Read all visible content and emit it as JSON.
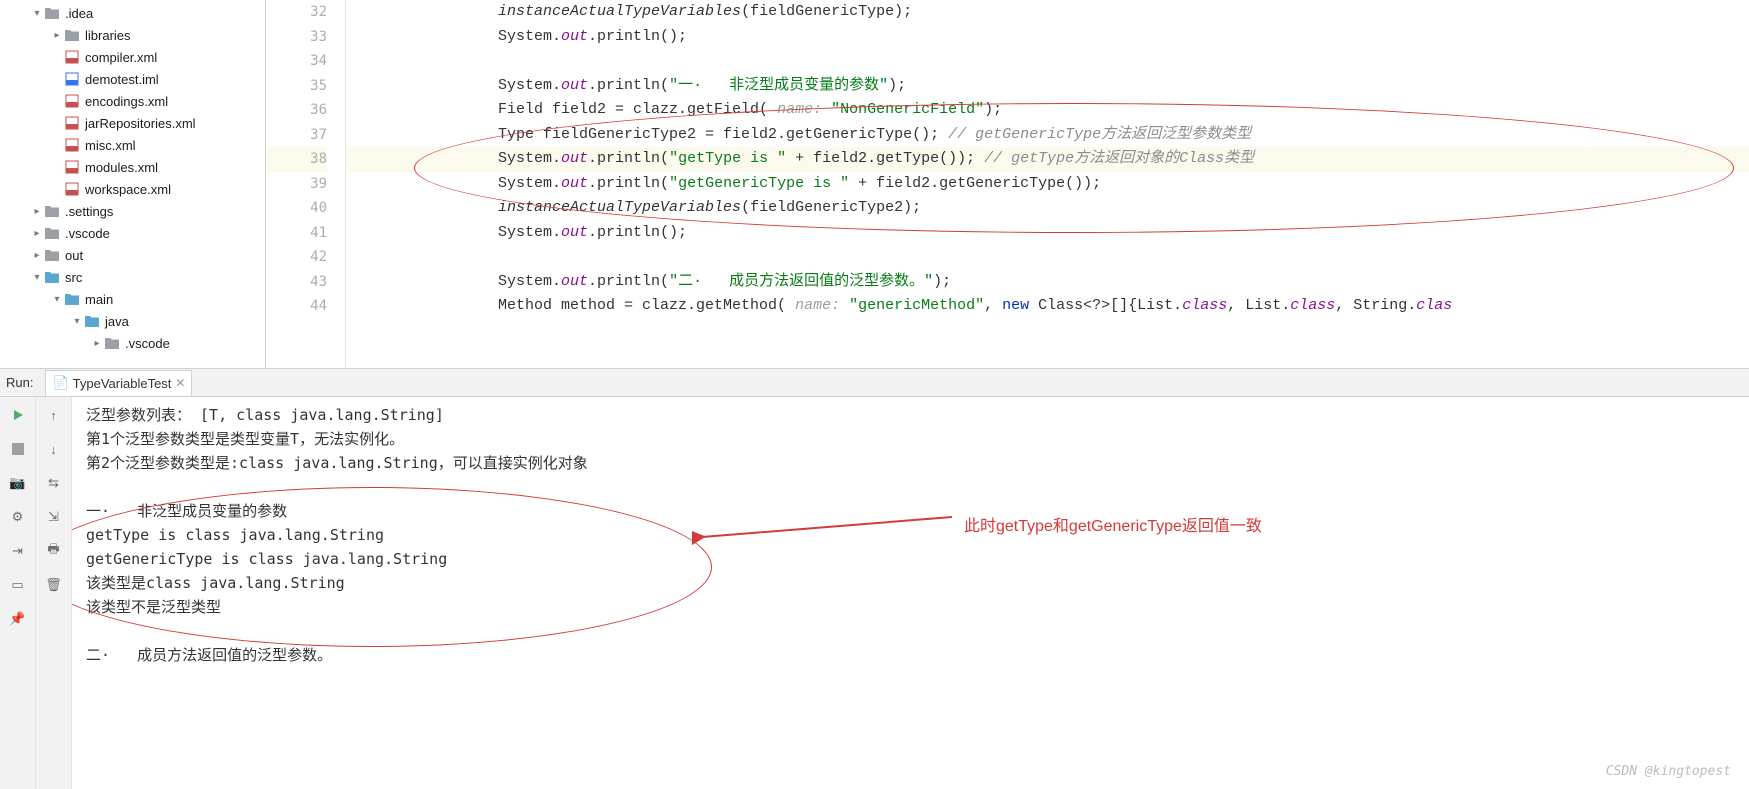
{
  "tree": [
    {
      "indent": 20,
      "arrow": "▾",
      "icon": "folder-gray",
      "label": ".idea"
    },
    {
      "indent": 40,
      "arrow": "▸",
      "icon": "folder-gray",
      "label": "libraries"
    },
    {
      "indent": 40,
      "arrow": "",
      "icon": "xml",
      "label": "compiler.xml"
    },
    {
      "indent": 40,
      "arrow": "",
      "icon": "iml",
      "label": "demotest.iml"
    },
    {
      "indent": 40,
      "arrow": "",
      "icon": "xml",
      "label": "encodings.xml"
    },
    {
      "indent": 40,
      "arrow": "",
      "icon": "xml",
      "label": "jarRepositories.xml"
    },
    {
      "indent": 40,
      "arrow": "",
      "icon": "xml",
      "label": "misc.xml"
    },
    {
      "indent": 40,
      "arrow": "",
      "icon": "xml",
      "label": "modules.xml"
    },
    {
      "indent": 40,
      "arrow": "",
      "icon": "xml",
      "label": "workspace.xml"
    },
    {
      "indent": 20,
      "arrow": "▸",
      "icon": "folder-gray",
      "label": ".settings"
    },
    {
      "indent": 20,
      "arrow": "▸",
      "icon": "folder-gray",
      "label": ".vscode"
    },
    {
      "indent": 20,
      "arrow": "▸",
      "icon": "folder-gray",
      "label": "out"
    },
    {
      "indent": 20,
      "arrow": "▾",
      "icon": "folder-blue",
      "label": "src"
    },
    {
      "indent": 40,
      "arrow": "▾",
      "icon": "folder-blue",
      "label": "main"
    },
    {
      "indent": 60,
      "arrow": "▾",
      "icon": "folder-blue",
      "label": "java"
    },
    {
      "indent": 80,
      "arrow": "▸",
      "icon": "folder-gray",
      "label": ".vscode"
    }
  ],
  "gutter": [
    "32",
    "33",
    "34",
    "35",
    "36",
    "37",
    "38",
    "39",
    "40",
    "41",
    "42",
    "43",
    "44"
  ],
  "highlight_line": "38",
  "code": {
    "l32": {
      "pre": "        ",
      "ital": "instanceActualTypeVariables",
      "post": "(fieldGenericType);"
    },
    "l33": {
      "pre": "        System.",
      "s": "out",
      "post": ".println();"
    },
    "l34": {
      "pre": ""
    },
    "l35": {
      "pre": "        System.",
      "s": "out",
      "m": ".println(",
      "str": "\"一·   非泛型成员变量的参数\"",
      "end": ");"
    },
    "l36": {
      "pre": "        Field field2 = clazz.getField( ",
      "param": "name:",
      "sp": " ",
      "str": "\"NonGenericField\"",
      "end": ");"
    },
    "l37": {
      "pre": "        Type fieldGenericType2 = field2.getGenericType(); ",
      "c": "// getGenericType方法返回泛型参数类型"
    },
    "l38": {
      "pre": "        System.",
      "s": "out",
      "m": ".println(",
      "str": "\"getType is \"",
      "mid": " + field2.getType()); ",
      "c": "// getType方法返回对象的Class类型"
    },
    "l39": {
      "pre": "        System.",
      "s": "out",
      "m": ".println(",
      "str": "\"getGenericType is \"",
      "mid": " + field2.getGenericType());"
    },
    "l40": {
      "pre": "        ",
      "ital": "instanceActualTypeVariables",
      "post": "(fieldGenericType2);"
    },
    "l41": {
      "pre": "        System.",
      "s": "out",
      "post": ".println();"
    },
    "l42": {
      "pre": ""
    },
    "l43": {
      "pre": "        System.",
      "s": "out",
      "m": ".println(",
      "str": "\"二·   成员方法返回值的泛型参数。\"",
      "end": ");"
    },
    "l44": {
      "pre": "        Method method = clazz.getMethod( ",
      "param": "name:",
      "sp": " ",
      "str": "\"genericMethod\"",
      "mid": ", ",
      "kw": "new",
      "post": " Class<?>[]{List.",
      "cls": "class",
      "p2": ", List.",
      "cls2": "class",
      "p3": ", String.",
      "cls3": "clas"
    }
  },
  "run": {
    "label": "Run:",
    "tab": "TypeVariableTest"
  },
  "console": [
    "泛型参数列表： [T, class java.lang.String]",
    "第1个泛型参数类型是类型变量T，无法实例化。",
    "第2个泛型参数类型是:class java.lang.String，可以直接实例化对象",
    "",
    "一·   非泛型成员变量的参数",
    "getType is class java.lang.String",
    "getGenericType is class java.lang.String",
    "该类型是class java.lang.String",
    "该类型不是泛型类型",
    "",
    "二·   成员方法返回值的泛型参数。"
  ],
  "annotation": "此时getType和getGenericType返回值一致",
  "watermark": "CSDN @kingtopest"
}
